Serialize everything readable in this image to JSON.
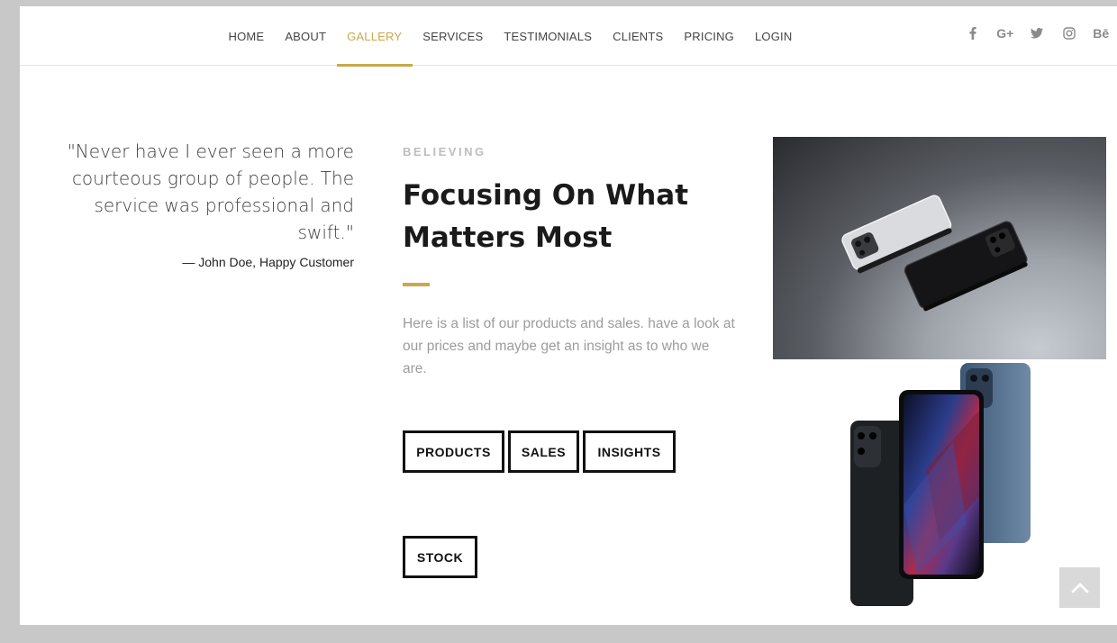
{
  "nav": {
    "items": [
      {
        "label": "HOME",
        "active": false
      },
      {
        "label": "ABOUT",
        "active": false
      },
      {
        "label": "GALLERY",
        "active": true
      },
      {
        "label": "SERVICES",
        "active": false
      },
      {
        "label": "TESTIMONIALS",
        "active": false
      },
      {
        "label": "CLIENTS",
        "active": false
      },
      {
        "label": "PRICING",
        "active": false
      },
      {
        "label": "LOGIN",
        "active": false
      }
    ],
    "accent_color": "#c9a94a"
  },
  "social": {
    "icons": [
      "facebook-icon",
      "google-plus-icon",
      "twitter-icon",
      "instagram-icon",
      "behance-icon"
    ],
    "google_plus_label": "G+",
    "behance_label": "Bē"
  },
  "testimonial": {
    "quote": "\"Never have I ever seen a more courteous group of people. The service was professional and swift.\"",
    "author": "— John Doe, Happy Customer"
  },
  "section": {
    "eyebrow": "BELIEVING",
    "heading": "Focusing On What Matters Most",
    "description": "Here is a list of our products and sales. have a look at our prices and maybe get an insight as to who we are."
  },
  "buttons": {
    "products": "PRODUCTS",
    "sales": "SALES",
    "insights": "INSIGHTS",
    "stock": "STOCK"
  },
  "images": {
    "top": "phones-floating-photo",
    "bottom": "phones-lineup-photo"
  },
  "scroll_top_icon": "chevron-up-icon"
}
